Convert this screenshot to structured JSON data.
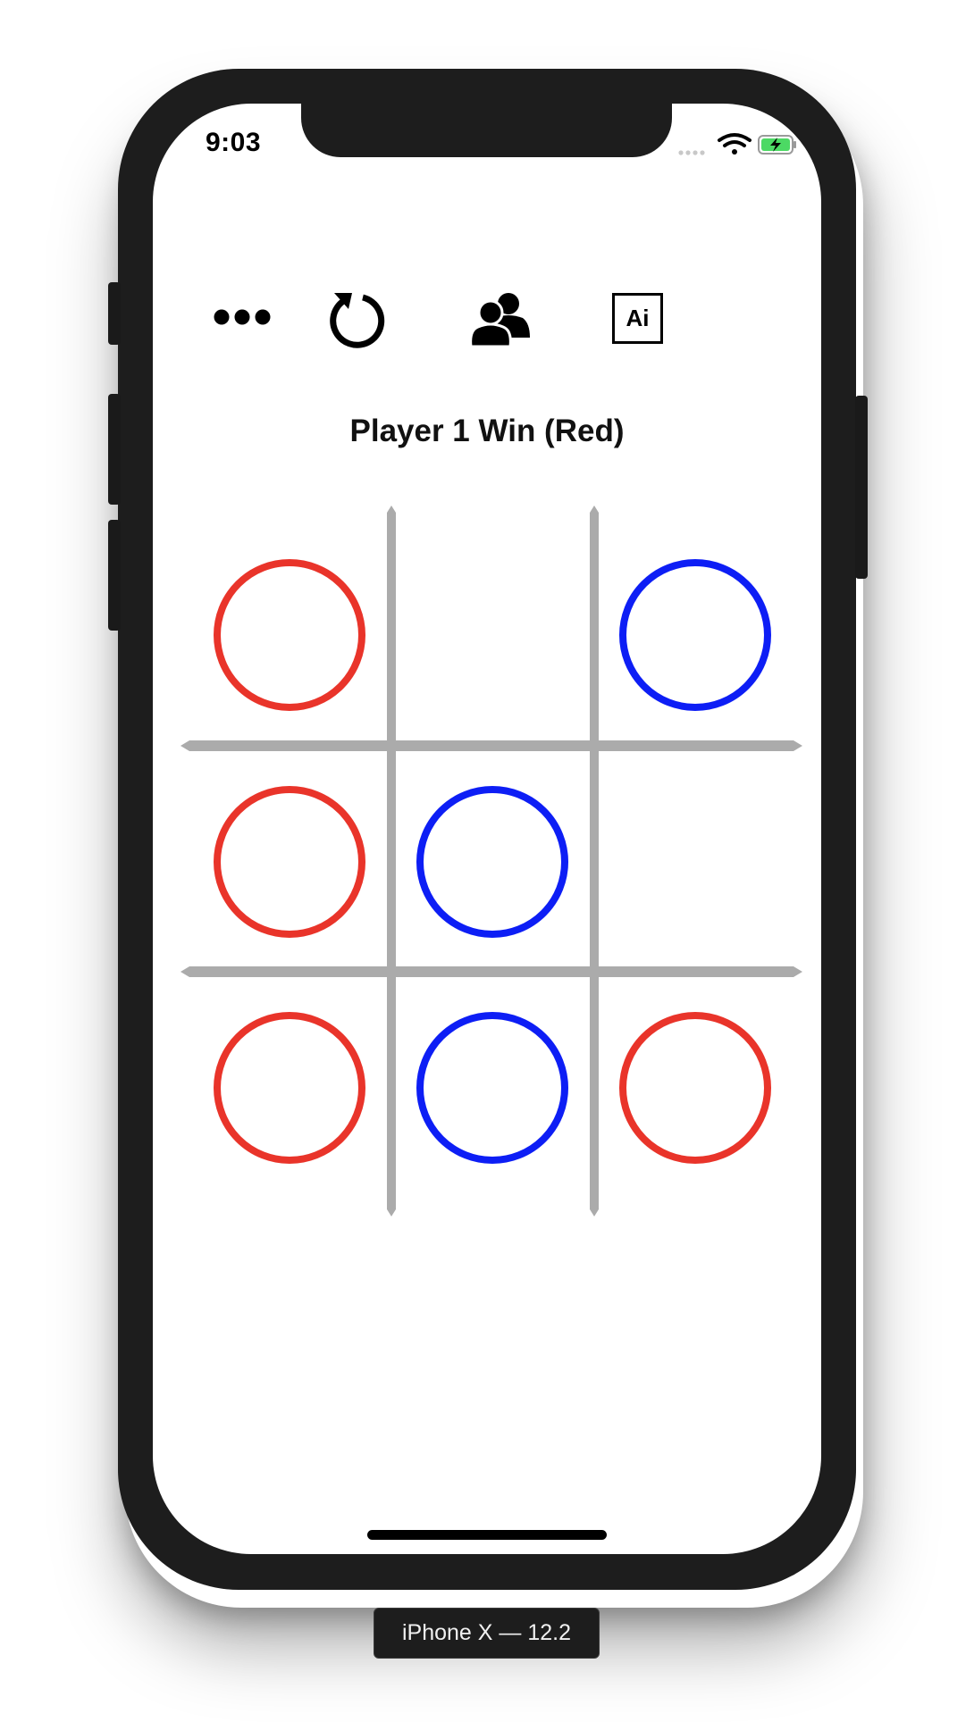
{
  "status_bar": {
    "time": "9:03",
    "signal_icon": "signal-dots-icon",
    "wifi_icon": "wifi-icon",
    "battery_icon": "battery-charging-icon"
  },
  "toolbar": {
    "items": [
      {
        "name": "more-button",
        "icon": "ellipsis-icon"
      },
      {
        "name": "restart-button",
        "icon": "restart-icon"
      },
      {
        "name": "two-player-button",
        "icon": "users-icon"
      },
      {
        "name": "ai-button",
        "icon": "ai-icon",
        "label": "Ai"
      }
    ]
  },
  "game": {
    "status_text": "Player 1 Win (Red)",
    "board": [
      [
        "red",
        "",
        "blue"
      ],
      [
        "red",
        "blue",
        ""
      ],
      [
        "red",
        "blue",
        "red"
      ]
    ],
    "colors": {
      "red": "#e9342a",
      "blue": "#0d1ef5",
      "grid": "#ababab"
    }
  },
  "device": {
    "label": "iPhone X — 12.2"
  }
}
